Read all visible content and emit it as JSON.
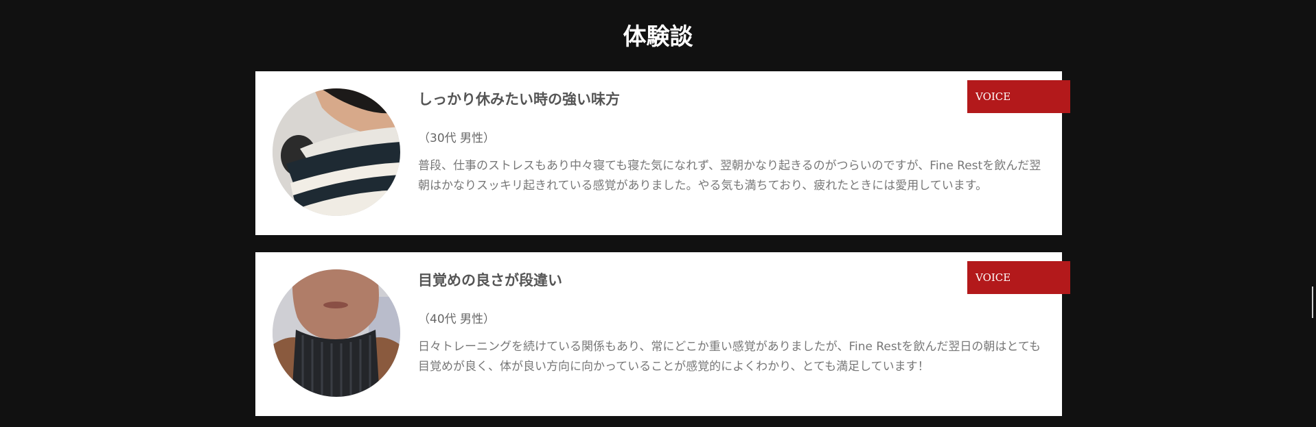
{
  "section": {
    "title": "体験談"
  },
  "testimonials": [
    {
      "badge": "VOICE",
      "title": "しっかり休みたい時の強い味方",
      "meta": "（30代 男性）",
      "body": "普段、仕事のストレスもあり中々寝ても寝た気になれず、翌朝かなり起きるのがつらいのですが、Fine Restを飲んだ翌朝はかなりスッキリ起きれている感覚がありました。やる気も満ちており、疲れたときには愛用しています。",
      "photo_icon": "man-striped-sweater-photo"
    },
    {
      "badge": "VOICE",
      "title": "目覚めの良さが段違い",
      "meta": "（40代 男性）",
      "body": "日々トレーニングを続けている関係もあり、常にどこか重い感覚がありましたが、Fine Restを飲んだ翌日の朝はとても目覚めが良く、体が良い方向に向かっていることが感覚的によくわかり、とても満足しています！",
      "photo_icon": "man-turtleneck-photo"
    }
  ],
  "colors": {
    "page_background": "#111111",
    "card_background": "#ffffff",
    "badge_background": "#b3191b",
    "title_text": "#555555",
    "body_text": "#777777"
  }
}
